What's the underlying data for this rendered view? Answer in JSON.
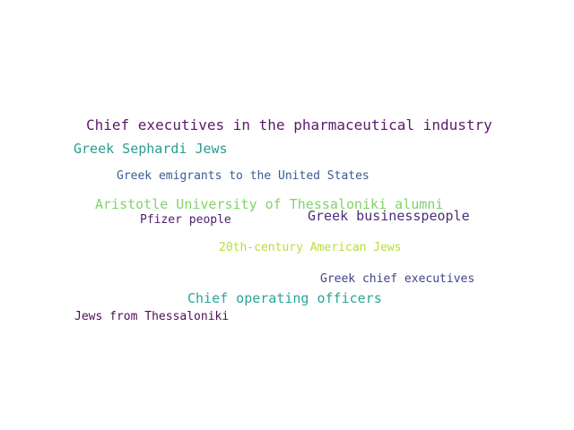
{
  "cloud": {
    "words": [
      {
        "text": "Chief executives in the pharmaceutical industry",
        "color": "#5b1a6b"
      },
      {
        "text": "Greek Sephardi Jews",
        "color": "#2a9d8f"
      },
      {
        "text": "Greek emigrants to the United States",
        "color": "#3b5b92"
      },
      {
        "text": "Aristotle University of Thessaloniki alumni",
        "color": "#7fd36a"
      },
      {
        "text": "Greek businesspeople",
        "color": "#4a2f7a"
      },
      {
        "text": "Pfizer people",
        "color": "#4a1f6b"
      },
      {
        "text": "20th-century American Jews",
        "color": "#b8dd3a"
      },
      {
        "text": "Greek chief executives",
        "color": "#414487"
      },
      {
        "text": "Chief operating officers",
        "color": "#2aa59a"
      },
      {
        "text": "Jews from Thessaloniki",
        "color": "#4b1053"
      }
    ]
  }
}
